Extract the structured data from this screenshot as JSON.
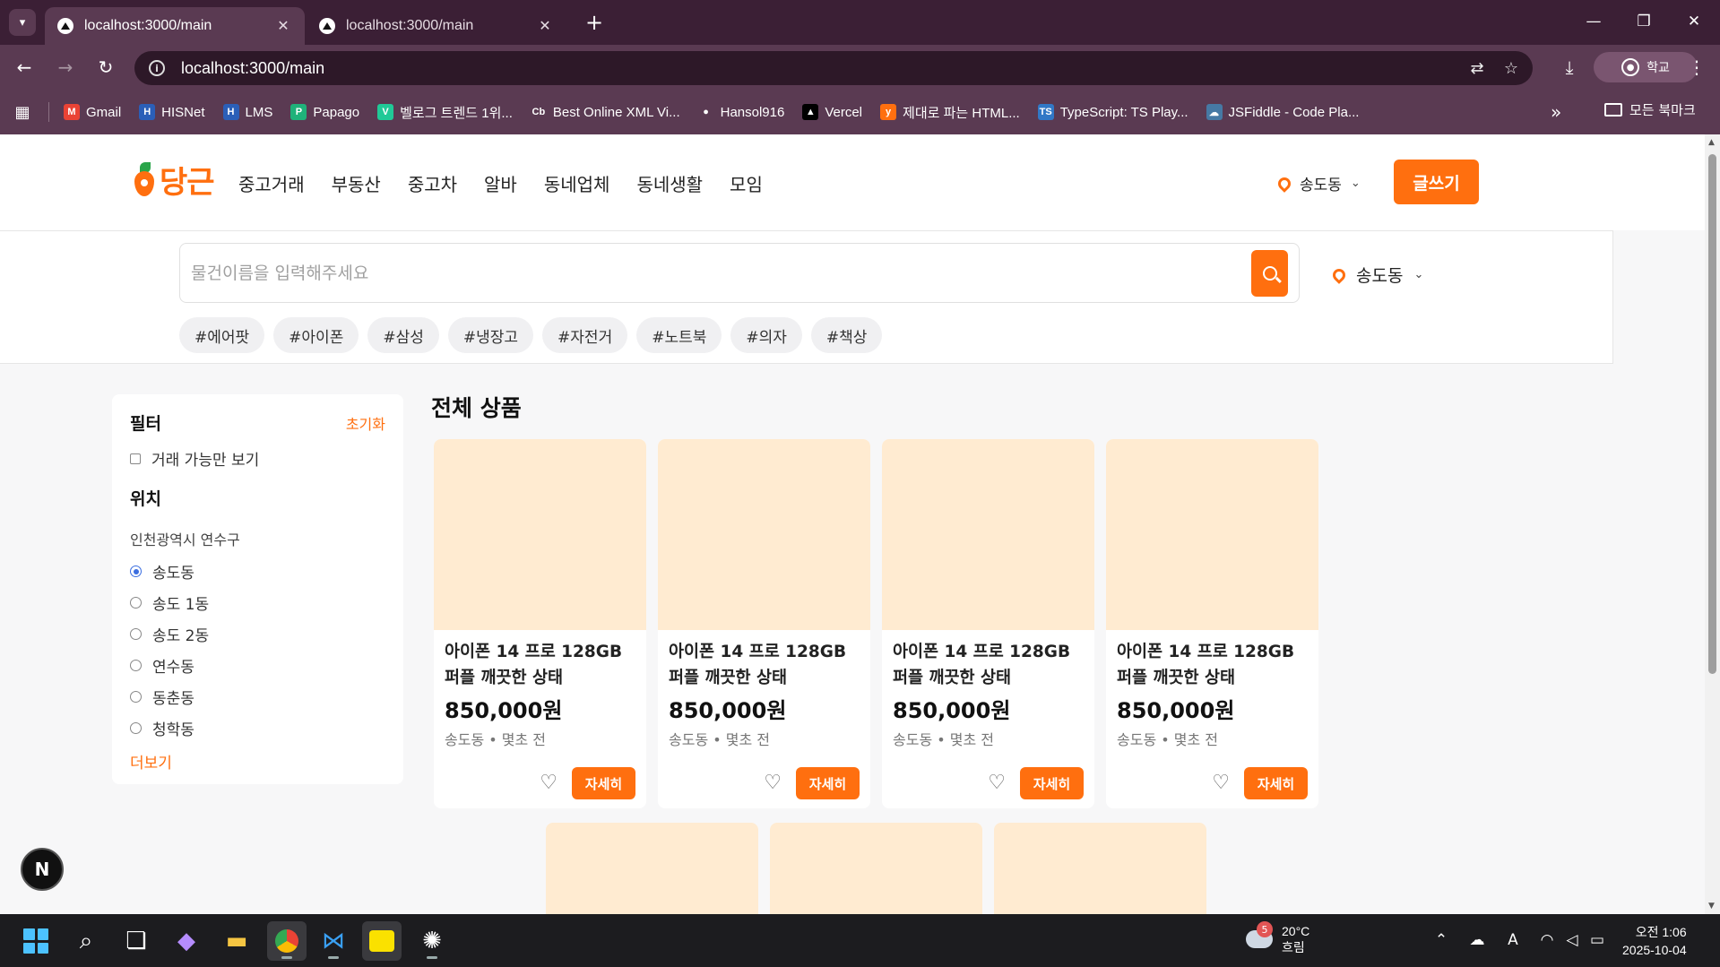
{
  "browser": {
    "tabs": [
      {
        "title": "localhost:3000/main",
        "active": true
      },
      {
        "title": "localhost:3000/main",
        "active": false
      }
    ],
    "url": "localhost:3000/main",
    "profile_label": "학교",
    "bookmarks": [
      {
        "label": "Gmail",
        "icon": "gmail-icon",
        "color": "#ea4335",
        "glyph": "M"
      },
      {
        "label": "HISNet",
        "icon": "hisnet-icon",
        "color": "#2b5fb8",
        "glyph": "H"
      },
      {
        "label": "LMS",
        "icon": "lms-icon",
        "color": "#2b5fb8",
        "glyph": "H"
      },
      {
        "label": "Papago",
        "icon": "papago-icon",
        "color": "#1fb27a",
        "glyph": "P"
      },
      {
        "label": "벨로그 트렌드 1위...",
        "icon": "velog-icon",
        "color": "#20c997",
        "glyph": "V"
      },
      {
        "label": "Best Online XML Vi...",
        "icon": "codebeautify-icon",
        "color": "#ffffff",
        "glyph": "Cb"
      },
      {
        "label": "Hansol916",
        "icon": "github-icon",
        "color": "#ffffff",
        "glyph": "●"
      },
      {
        "label": "Vercel",
        "icon": "vercel-icon",
        "color": "#000000",
        "glyph": "▲"
      },
      {
        "label": "제대로 파는 HTML...",
        "icon": "yalco-icon",
        "color": "#ff6f0f",
        "glyph": "y"
      },
      {
        "label": "TypeScript: TS Play...",
        "icon": "typescript-icon",
        "color": "#3178c6",
        "glyph": "TS"
      },
      {
        "label": "JSFiddle - Code Pla...",
        "icon": "jsfiddle-icon",
        "color": "#4679a4",
        "glyph": "☁"
      }
    ],
    "all_bookmarks_label": "모든 북마크"
  },
  "site": {
    "brand": "당근",
    "accent_color": "#ff6f0f",
    "nav": [
      "중고거래",
      "부동산",
      "중고차",
      "알바",
      "동네업체",
      "동네생활",
      "모임"
    ],
    "location": "송도동",
    "write_label": "글쓰기"
  },
  "search": {
    "placeholder": "물건이름을 입력해주세요",
    "value": "",
    "location": "송도동",
    "tags": [
      "#에어팟",
      "#아이폰",
      "#삼성",
      "#냉장고",
      "#자전거",
      "#노트북",
      "#의자",
      "#책상"
    ]
  },
  "filter": {
    "title": "필터",
    "reset_label": "초기화",
    "available_only_label": "거래 가능만 보기",
    "location_title": "위치",
    "region": "인천광역시 연수구",
    "options": [
      {
        "label": "송도동",
        "checked": true
      },
      {
        "label": "송도 1동",
        "checked": false
      },
      {
        "label": "송도 2동",
        "checked": false
      },
      {
        "label": "연수동",
        "checked": false
      },
      {
        "label": "동춘동",
        "checked": false
      },
      {
        "label": "청학동",
        "checked": false
      }
    ],
    "more_label": "더보기"
  },
  "products": {
    "title": "전체 상품",
    "items": [
      {
        "name_line1": "아이폰 14 프로 128GB",
        "name_line2": "퍼플 깨끗한 상태",
        "price": "850,000원",
        "meta": "송도동 • 몇초 전",
        "detail_label": "자세히"
      },
      {
        "name_line1": "아이폰 14 프로 128GB",
        "name_line2": "퍼플 깨끗한 상태",
        "price": "850,000원",
        "meta": "송도동 • 몇초 전",
        "detail_label": "자세히"
      },
      {
        "name_line1": "아이폰 14 프로 128GB",
        "name_line2": "퍼플 깨끗한 상태",
        "price": "850,000원",
        "meta": "송도동 • 몇초 전",
        "detail_label": "자세히"
      },
      {
        "name_line1": "아이폰 14 프로 128GB",
        "name_line2": "퍼플 깨끗한 상태",
        "price": "850,000원",
        "meta": "송도동 • 몇초 전",
        "detail_label": "자세히"
      }
    ]
  },
  "dev_badge": "N",
  "taskbar": {
    "weather_temp": "20°C",
    "weather_desc": "흐림",
    "weather_badge": "5",
    "time": "오전 1:06",
    "date": "2025-10-04"
  }
}
